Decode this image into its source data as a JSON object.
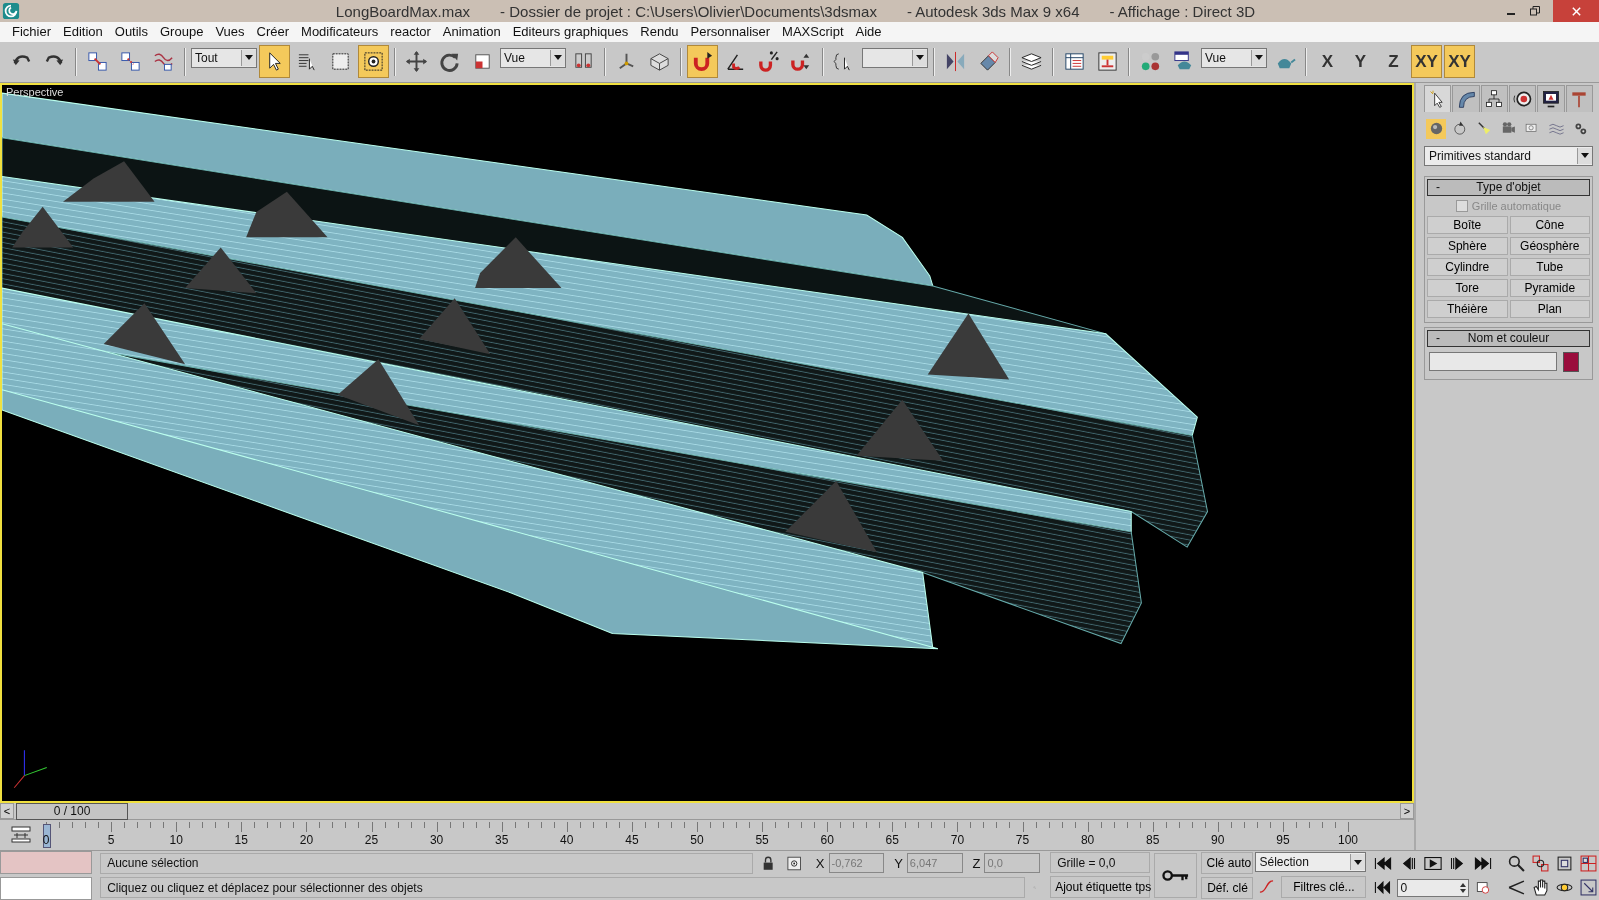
{
  "window": {
    "title_parts": [
      "LongBoardMax.max",
      "- Dossier de projet : C:\\Users\\Olivier\\Documents\\3dsmax",
      "- Autodesk 3ds Max 9 x64",
      "- Affichage : Direct 3D"
    ]
  },
  "menu": [
    "Fichier",
    "Edition",
    "Outils",
    "Groupe",
    "Vues",
    "Créer",
    "Modificateurs",
    "reactor",
    "Animation",
    "Editeurs graphiques",
    "Rendu",
    "Personnaliser",
    "MAXScript",
    "Aide"
  ],
  "toolbar": [
    {
      "kind": "icon",
      "selected": false
    },
    {
      "kind": "icon",
      "selected": false
    },
    {
      "kind": "sep"
    },
    {
      "kind": "icon",
      "selected": false
    },
    {
      "kind": "icon",
      "selected": false
    },
    {
      "kind": "icon",
      "selected": false
    },
    {
      "kind": "sep"
    },
    {
      "kind": "dropdown",
      "value": "Tout"
    },
    {
      "kind": "icon",
      "selected": true
    },
    {
      "kind": "icon",
      "selected": false
    },
    {
      "kind": "icon",
      "selected": false
    },
    {
      "kind": "icon",
      "selected": true
    },
    {
      "kind": "sep"
    },
    {
      "kind": "icon",
      "selected": false
    },
    {
      "kind": "icon",
      "selected": false
    },
    {
      "kind": "icon",
      "selected": false
    },
    {
      "kind": "dropdown",
      "value": "Vue"
    },
    {
      "kind": "icon",
      "selected": false
    },
    {
      "kind": "sep"
    },
    {
      "kind": "icon",
      "selected": false
    },
    {
      "kind": "icon",
      "selected": false
    },
    {
      "kind": "sep"
    },
    {
      "kind": "icon",
      "selected": true
    },
    {
      "kind": "icon",
      "selected": false
    },
    {
      "kind": "icon",
      "selected": false
    },
    {
      "kind": "icon",
      "selected": false
    },
    {
      "kind": "sep"
    },
    {
      "kind": "icon",
      "selected": false
    },
    {
      "kind": "dropdown"
    },
    {
      "kind": "sep"
    },
    {
      "kind": "icon",
      "selected": false
    },
    {
      "kind": "icon",
      "selected": false
    },
    {
      "kind": "sep"
    },
    {
      "kind": "icon",
      "selected": false
    },
    {
      "kind": "sep"
    },
    {
      "kind": "icon",
      "selected": false
    },
    {
      "kind": "icon",
      "selected": false
    },
    {
      "kind": "sep"
    },
    {
      "kind": "icon",
      "selected": false
    },
    {
      "kind": "icon",
      "selected": false
    },
    {
      "kind": "dropdown",
      "value": "Vue"
    },
    {
      "kind": "icon",
      "selected": false
    },
    {
      "kind": "sep"
    },
    {
      "kind": "axis",
      "label": "X",
      "selected": false
    },
    {
      "kind": "axis",
      "label": "Y",
      "selected": false
    },
    {
      "kind": "axis",
      "label": "Z",
      "selected": false
    },
    {
      "kind": "axis",
      "label": "XY",
      "selected": true
    },
    {
      "kind": "axis",
      "label": "XY",
      "selected": true
    }
  ],
  "viewport": {
    "label": "Perspective"
  },
  "command_panel": {
    "tabs": [
      {
        "selected": true
      },
      {
        "selected": false
      },
      {
        "selected": false
      },
      {
        "selected": false
      },
      {
        "selected": false
      },
      {
        "selected": false
      }
    ],
    "categories": [
      {
        "selected": true
      },
      {
        "selected": false
      },
      {
        "selected": false
      },
      {
        "selected": false
      },
      {
        "selected": false
      },
      {
        "selected": false
      },
      {
        "selected": false
      }
    ],
    "type_dropdown": "Primitives standard",
    "object_type": {
      "toggle": "-",
      "title": "Type d'objet",
      "autogrid": {
        "label": "Grille automatique",
        "checked": false,
        "disabled": true
      },
      "buttons": [
        "Boîte",
        "Cône",
        "Sphère",
        "Géosphère",
        "Cylindre",
        "Tube",
        "Tore",
        "Pyramide",
        "Théière",
        "Plan"
      ]
    },
    "name_color": {
      "toggle": "-",
      "title": "Nom et couleur",
      "color": "#9a0c3c"
    }
  },
  "time_slider": {
    "prev": "<",
    "position": "0 / 100",
    "next": ">"
  },
  "track": {
    "ticks": [
      "0",
      "5",
      "10",
      "15",
      "20",
      "25",
      "30",
      "35",
      "40",
      "45",
      "50",
      "55",
      "60",
      "65",
      "70",
      "75",
      "80",
      "85",
      "90",
      "95",
      "100"
    ]
  },
  "status": {
    "selection": "Aucune sélection",
    "prompt": "Cliquez ou cliquez et déplacez pour sélectionner des objets",
    "coords": [
      {
        "label": "X",
        "value": "-0,762"
      },
      {
        "label": "Y",
        "value": "6,047"
      },
      {
        "label": "Z",
        "value": "0,0"
      }
    ],
    "grid": "Grille = 0,0",
    "time_tag": "Ajout étiquette tps",
    "auto_key": "Clé auto",
    "set_key": "Déf. clé",
    "key_mode": "Sélection",
    "key_filters": "Filtres clé...",
    "frame": "0"
  }
}
